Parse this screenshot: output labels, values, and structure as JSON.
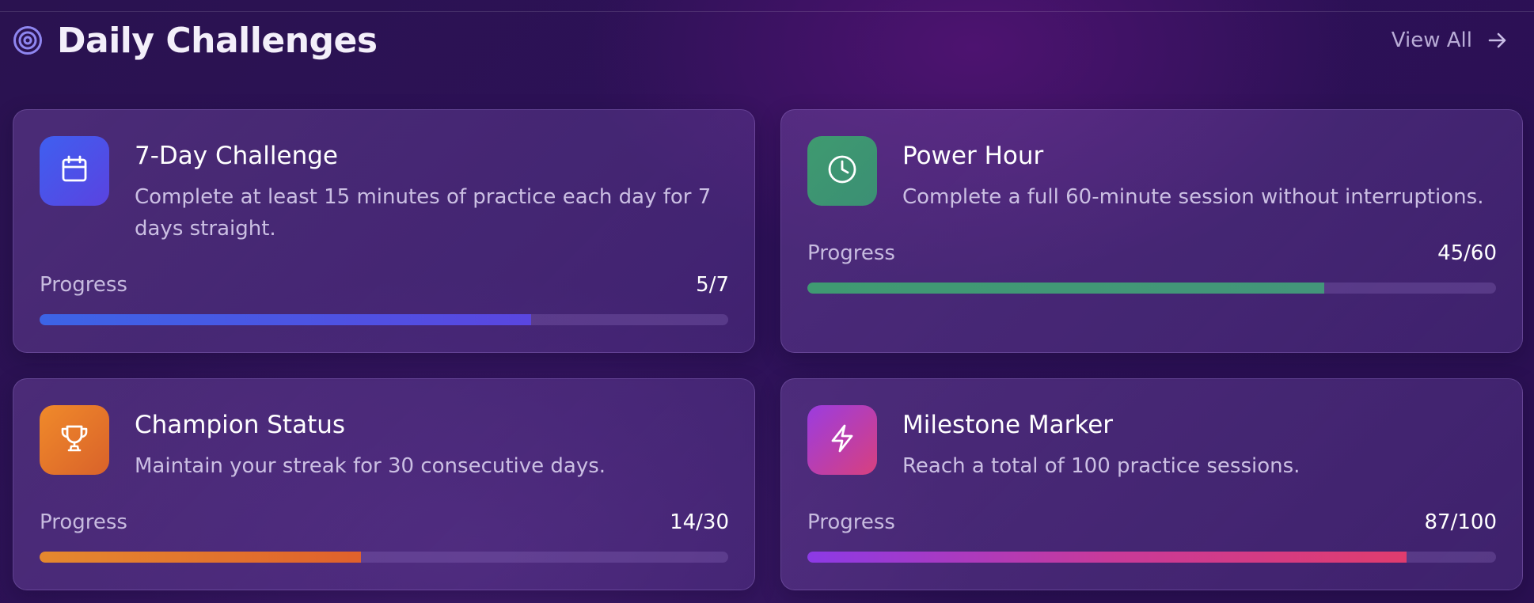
{
  "header": {
    "title": "Daily Challenges",
    "view_all_label": "View All",
    "title_icon": "target-icon",
    "view_all_icon": "arrow-right-icon"
  },
  "challenges": [
    {
      "title": "7-Day Challenge",
      "description": "Complete at least 15 minutes of practice each day for 7 days straight.",
      "progress_label": "Progress",
      "progress_text": "5/7",
      "progress_fraction": 0.714,
      "icon": "calendar-icon",
      "color": "#4a55e8"
    },
    {
      "title": "Power Hour",
      "description": "Complete a full 60-minute session without interruptions.",
      "progress_label": "Progress",
      "progress_text": "45/60",
      "progress_fraction": 0.75,
      "icon": "clock-icon",
      "color": "#3f9a72"
    },
    {
      "title": "Champion Status",
      "description": "Maintain your streak for 30 consecutive days.",
      "progress_label": "Progress",
      "progress_text": "14/30",
      "progress_fraction": 0.467,
      "icon": "trophy-icon",
      "color": "#e57a2c"
    },
    {
      "title": "Milestone Marker",
      "description": "Reach a total of 100 practice sessions.",
      "progress_label": "Progress",
      "progress_text": "87/100",
      "progress_fraction": 0.87,
      "icon": "lightning-icon",
      "color": "#c23ca0"
    }
  ]
}
